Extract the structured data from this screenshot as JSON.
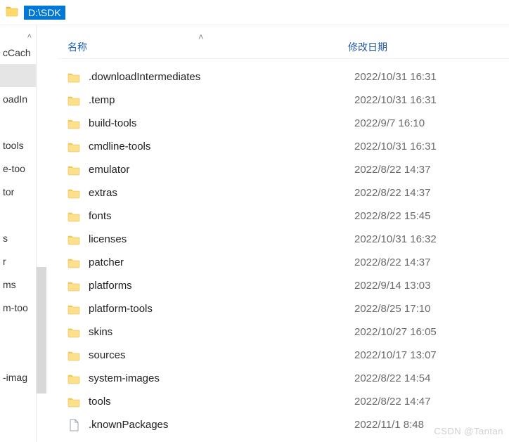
{
  "address": {
    "path": "D:\\SDK"
  },
  "columns": {
    "name": "名称",
    "date": "修改日期"
  },
  "nav": {
    "items": [
      {
        "label": "cCach"
      },
      {
        "label": ""
      },
      {
        "label": "oadIn"
      },
      {
        "label": ""
      },
      {
        "label": "tools"
      },
      {
        "label": "e-too"
      },
      {
        "label": "tor"
      },
      {
        "label": ""
      },
      {
        "label": "s"
      },
      {
        "label": "r"
      },
      {
        "label": "ms"
      },
      {
        "label": "m-too"
      },
      {
        "label": ""
      },
      {
        "label": ""
      },
      {
        "label": "-imag"
      }
    ]
  },
  "files": [
    {
      "name": ".downloadIntermediates",
      "date": "2022/10/31 16:31",
      "type": "folder"
    },
    {
      "name": ".temp",
      "date": "2022/10/31 16:31",
      "type": "folder"
    },
    {
      "name": "build-tools",
      "date": "2022/9/7 16:10",
      "type": "folder"
    },
    {
      "name": "cmdline-tools",
      "date": "2022/10/31 16:31",
      "type": "folder"
    },
    {
      "name": "emulator",
      "date": "2022/8/22 14:37",
      "type": "folder"
    },
    {
      "name": "extras",
      "date": "2022/8/22 14:37",
      "type": "folder"
    },
    {
      "name": "fonts",
      "date": "2022/8/22 15:45",
      "type": "folder"
    },
    {
      "name": "licenses",
      "date": "2022/10/31 16:32",
      "type": "folder"
    },
    {
      "name": "patcher",
      "date": "2022/8/22 14:37",
      "type": "folder"
    },
    {
      "name": "platforms",
      "date": "2022/9/14 13:03",
      "type": "folder"
    },
    {
      "name": "platform-tools",
      "date": "2022/8/25 17:10",
      "type": "folder"
    },
    {
      "name": "skins",
      "date": "2022/10/27 16:05",
      "type": "folder"
    },
    {
      "name": "sources",
      "date": "2022/10/17 13:07",
      "type": "folder"
    },
    {
      "name": "system-images",
      "date": "2022/8/22 14:54",
      "type": "folder"
    },
    {
      "name": "tools",
      "date": "2022/8/22 14:47",
      "type": "folder"
    },
    {
      "name": ".knownPackages",
      "date": "2022/11/1 8:48",
      "type": "file"
    }
  ],
  "watermark": "CSDN @Tantan"
}
